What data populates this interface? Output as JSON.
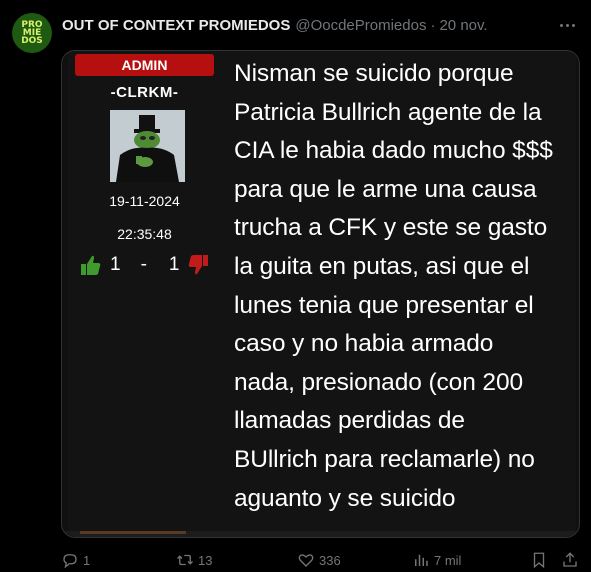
{
  "tweet": {
    "avatar_lines": [
      "PRO",
      "MIE",
      "DOS"
    ],
    "display_name": "OUT OF CONTEXT PROMIEDOS",
    "handle": "@OocdePromiedos",
    "separator": "·",
    "date": "20 nov."
  },
  "forum_post": {
    "badge": "ADMIN",
    "username": "-CLRKM-",
    "date": "19-11-2024",
    "time": "22:35:48",
    "votes_up": "1",
    "votes_sep": "-",
    "votes_down": "1",
    "body": "Nisman se suicido porque\nPatricia Bullrich agente de la\nCIA le habia dado mucho $$$\npara que le arme una causa\ntrucha a CFK y este se gasto\nla guita en putas, asi que el\nlunes tenia que presentar el\ncaso y no habia armado\nnada, presionado (con 200\nllamadas perdidas de\nBUllrich para reclamarle) no\naguanto y se suicido"
  },
  "actions": {
    "replies": "1",
    "reposts": "13",
    "likes": "336",
    "views": "7 mil"
  },
  "colors": {
    "background": "#000000",
    "muted": "#71767b",
    "admin_badge": "#b5100f",
    "thumb_up": "#3f9b2d",
    "thumb_down": "#c21b1b"
  },
  "icons": [
    "more-icon",
    "reply-icon",
    "repost-icon",
    "like-icon",
    "views-icon",
    "bookmark-icon",
    "share-icon",
    "thumb-up-icon",
    "thumb-down-icon"
  ]
}
